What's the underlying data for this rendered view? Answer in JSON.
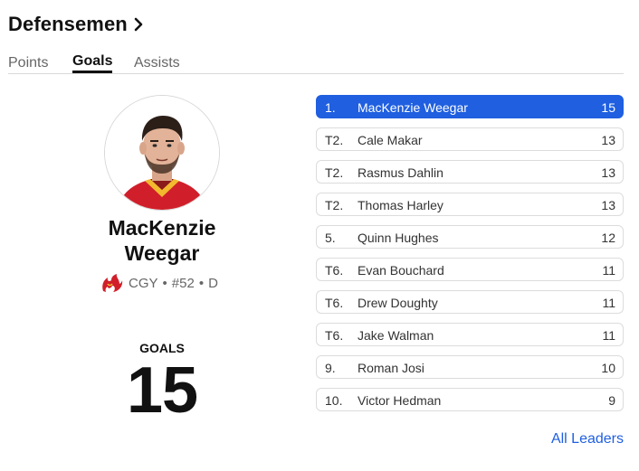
{
  "header": {
    "title": "Defensemen"
  },
  "tabs": [
    {
      "label": "Points",
      "active": false
    },
    {
      "label": "Goals",
      "active": true
    },
    {
      "label": "Assists",
      "active": false
    }
  ],
  "featured": {
    "first_name": "MacKenzie",
    "last_name": "Weegar",
    "team": "CGY",
    "number": "#52",
    "position": "D",
    "separator": "•",
    "stat_label": "GOALS",
    "stat_value": "15"
  },
  "leaders": [
    {
      "rank": "1.",
      "name": "MacKenzie Weegar",
      "value": "15"
    },
    {
      "rank": "T2.",
      "name": "Cale Makar",
      "value": "13"
    },
    {
      "rank": "T2.",
      "name": "Rasmus Dahlin",
      "value": "13"
    },
    {
      "rank": "T2.",
      "name": "Thomas Harley",
      "value": "13"
    },
    {
      "rank": "5.",
      "name": "Quinn Hughes",
      "value": "12"
    },
    {
      "rank": "T6.",
      "name": "Evan Bouchard",
      "value": "11"
    },
    {
      "rank": "T6.",
      "name": "Drew Doughty",
      "value": "11"
    },
    {
      "rank": "T6.",
      "name": "Jake Walman",
      "value": "11"
    },
    {
      "rank": "9.",
      "name": "Roman Josi",
      "value": "10"
    },
    {
      "rank": "10.",
      "name": "Victor Hedman",
      "value": "9"
    }
  ],
  "footer": {
    "all_leaders_label": "All Leaders"
  },
  "colors": {
    "accent": "#1f5fe0",
    "jersey_red": "#d01f2a",
    "jersey_yellow": "#f2b92e"
  },
  "icons": {
    "title_chevron": "chevron-right-icon",
    "team_logo": "flames-logo-icon"
  }
}
